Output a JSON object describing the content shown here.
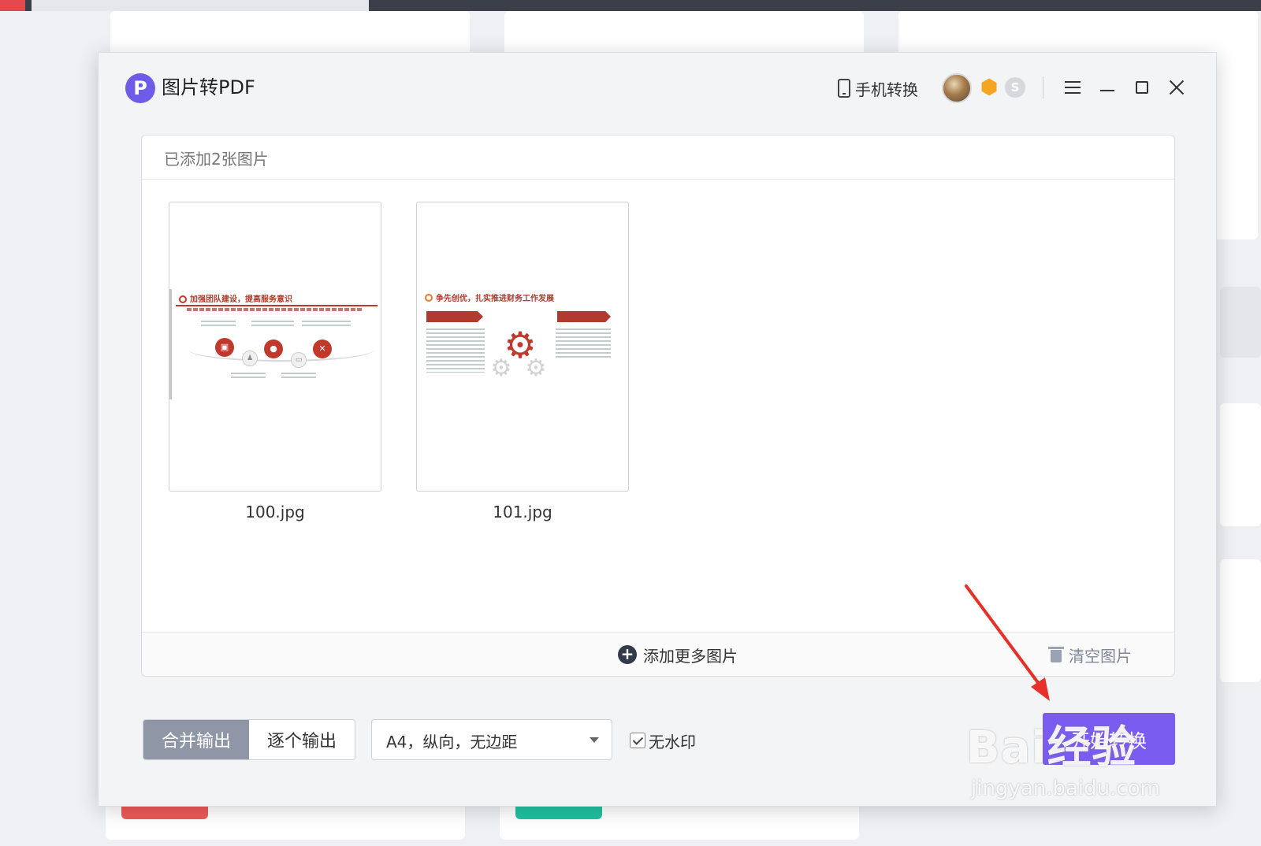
{
  "dialog": {
    "title": "图片转PDF",
    "logo_letter": "P",
    "phone_convert_label": "手机转换",
    "coin_letter": "S"
  },
  "panel": {
    "added_count_text": "已添加2张图片",
    "images": [
      {
        "filename": "100.jpg",
        "slide_title": "加强团队建设，提高服务意识"
      },
      {
        "filename": "101.jpg",
        "slide_title": "争先创优，扎实推进财务工作发展"
      }
    ],
    "add_more_label": "添加更多图片",
    "clear_label": "清空图片"
  },
  "controls": {
    "merge_output_label": "合并输出",
    "individual_output_label": "逐个输出",
    "page_setting_value": "A4，纵向，无边距",
    "no_watermark_label": "无水印",
    "start_label": "开始转换"
  },
  "colors": {
    "accent": "#7b5cf0",
    "logo": "#6c5ce7",
    "segment_active": "#8f97a6",
    "arrow": "#e8302a"
  },
  "watermark": {
    "brand": "Bai经验",
    "url": "jingyan.baidu.com"
  }
}
